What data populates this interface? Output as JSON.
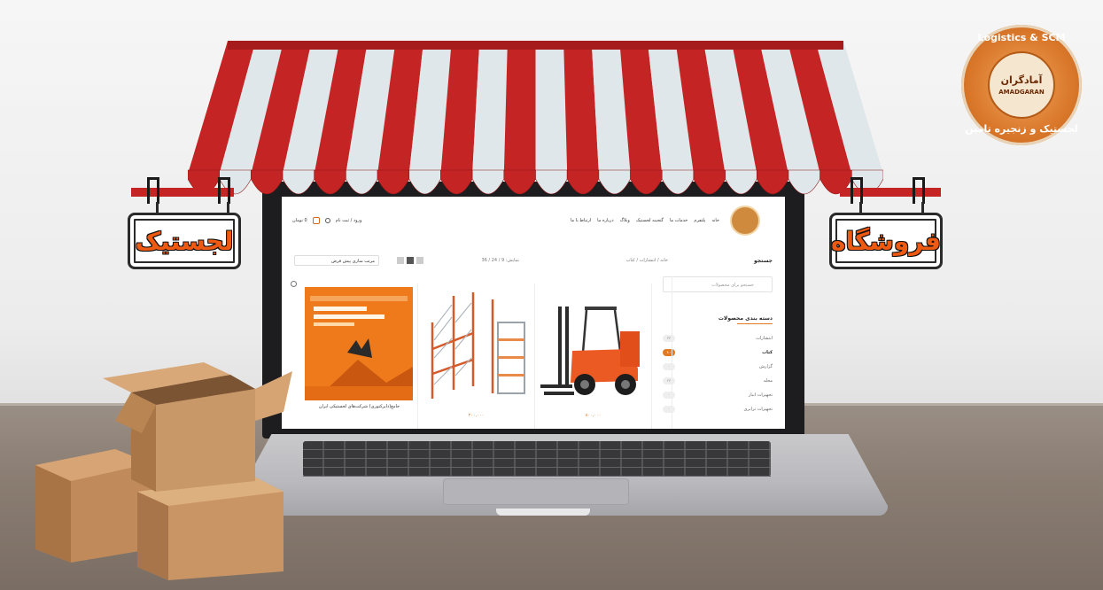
{
  "signs": {
    "left_label": "لجستیک",
    "right_label": "فروشگاه"
  },
  "logo": {
    "arc_top": "Logistics & SCM",
    "name_fa": "آمادگران",
    "name_en": "AMADGARAN",
    "arc_bottom": "لجستیک و زنجیره تامین"
  },
  "site": {
    "nav": [
      "خانه",
      "پلتفرم",
      "خدمات ما",
      "گنجینه لجستیک",
      "وبلاگ",
      "درباره ما",
      "ارتباط با ما"
    ],
    "login_label": "ورود / ثبت نام",
    "cart_label": "0 تومان",
    "sidebar_title": "جستجو",
    "breadcrumb": "خانه / انتشارات / کتاب",
    "showing": "نمایش: 9 / 24 / 36",
    "sort_label": "مرتب سازی پیش فرض",
    "search_placeholder": "جستجو برای محصولات",
    "categories_title": "دسته بندی محصولات",
    "categories": [
      {
        "label": "انتشارات",
        "count": "۳۳"
      },
      {
        "label": "کتاب",
        "count": "۱۰"
      },
      {
        "label": "گزارش",
        "count": "۰"
      },
      {
        "label": "مجله",
        "count": "۲۳"
      },
      {
        "label": "تجهیزات انبار",
        "count": "۰"
      },
      {
        "label": "تجهیزات ترابری",
        "count": "۰"
      }
    ],
    "products": [
      {
        "name": "جامع(دایرکتوری) شرکت‌های لجستیکی ایران",
        "price": ""
      },
      {
        "name": "",
        "price": "۲۰۰,۰۰۰"
      },
      {
        "name": "",
        "price": "۸۰۰,۰۰۰"
      }
    ]
  },
  "colors": {
    "awning_red": "#c42424",
    "awning_white": "#dfe7ea",
    "sign_text": "#ef5a12",
    "accent": "#e27a22"
  }
}
